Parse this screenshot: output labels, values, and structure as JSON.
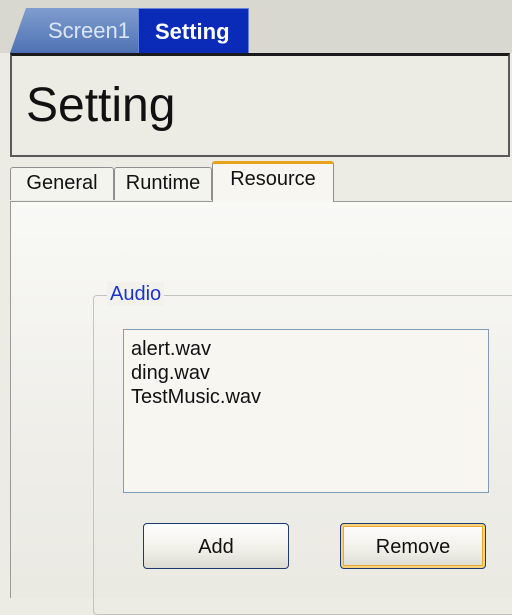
{
  "screen_tabs": [
    {
      "label": "Screen1",
      "active": false
    },
    {
      "label": "Setting",
      "active": true
    }
  ],
  "header": {
    "title": "Setting"
  },
  "tabs": [
    {
      "label": "General",
      "active": false
    },
    {
      "label": "Runtime",
      "active": false
    },
    {
      "label": "Resource",
      "active": true
    }
  ],
  "audio": {
    "group_label": "Audio",
    "files": [
      "alert.wav",
      "ding.wav",
      "TestMusic.wav"
    ],
    "add_label": "Add",
    "remove_label": "Remove"
  },
  "colors": {
    "active_screen_tab": "#0a2ab8",
    "active_tab_accent": "#e8a11b",
    "group_label": "#1c34c8"
  }
}
